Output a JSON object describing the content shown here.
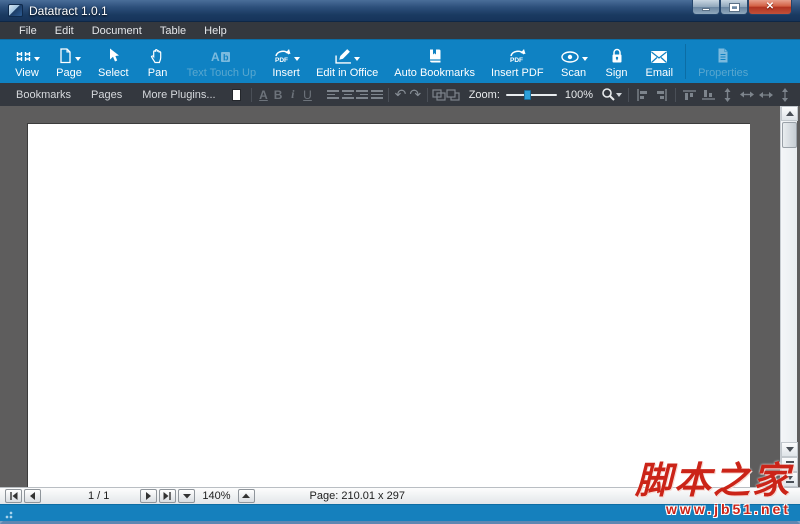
{
  "window": {
    "title": "Datatract 1.0.1"
  },
  "menu": {
    "items": [
      {
        "label": "File"
      },
      {
        "label": "Edit"
      },
      {
        "label": "Document"
      },
      {
        "label": "Table"
      },
      {
        "label": "Help"
      }
    ]
  },
  "toolbar": {
    "buttons": [
      {
        "label": "View",
        "dropdown": true,
        "disabled": false
      },
      {
        "label": "Page",
        "dropdown": true,
        "disabled": false
      },
      {
        "label": "Select",
        "dropdown": false,
        "disabled": false
      },
      {
        "label": "Pan",
        "dropdown": false,
        "disabled": false
      },
      {
        "label": "Text Touch Up",
        "dropdown": false,
        "disabled": true
      },
      {
        "label": "Insert",
        "dropdown": true,
        "disabled": false
      },
      {
        "label": "Edit in Office",
        "dropdown": true,
        "disabled": false
      },
      {
        "label": "Auto Bookmarks",
        "dropdown": false,
        "disabled": false
      },
      {
        "label": "Insert PDF",
        "dropdown": false,
        "disabled": false
      },
      {
        "label": "Scan",
        "dropdown": true,
        "disabled": false
      },
      {
        "label": "Sign",
        "dropdown": false,
        "disabled": false
      },
      {
        "label": "Email",
        "dropdown": false,
        "disabled": false
      },
      {
        "label": "Properties",
        "dropdown": false,
        "disabled": true
      }
    ]
  },
  "toolbar2": {
    "bookmarks_label": "Bookmarks",
    "pages_label": "Pages",
    "more_plugins_label": "More Plugins...",
    "font_glyph": "A",
    "bold_glyph": "B",
    "italic_glyph": "i",
    "underline_glyph": "U",
    "undo_glyph": "↶",
    "redo_glyph": "↷",
    "zoom_label": "Zoom:",
    "zoom_value": "100%"
  },
  "statusbar": {
    "page_indicator": "1 / 1",
    "zoom_value": "140%",
    "page_size_label": "Page: 210.01 x 297"
  },
  "watermark": {
    "site_name": "脚本之家",
    "site_url": "www.jb51.net"
  },
  "icons": {
    "app-logo": "two-tone blue wave square",
    "minimize": "–",
    "maximize": "□",
    "close": "✕",
    "view": "window panes grid",
    "page": "document outline",
    "select": "cursor arrow",
    "pan": "hand",
    "text-touch-up": "A+b letters",
    "insert": "circular arrow PDF",
    "edit-in-office": "pencil",
    "auto-bookmarks": "book",
    "insert-pdf": "circular arrow PDF",
    "scan": "eye",
    "sign": "padlock",
    "email": "envelope",
    "properties": "document sheet",
    "color-swatch": "white square",
    "align": "bar stacks",
    "zoom-search": "magnifier",
    "scroll-arrows": "triangles",
    "resize-grip": "dots"
  },
  "colors": {
    "toolbar_blue": "#0f82c3",
    "titlebar_blue": "#1c3a5e",
    "toolbar2_dark": "#34383f",
    "doc_background": "#5e5d5d",
    "close_red": "#c2503a",
    "watermark_red": "#cb2418"
  }
}
